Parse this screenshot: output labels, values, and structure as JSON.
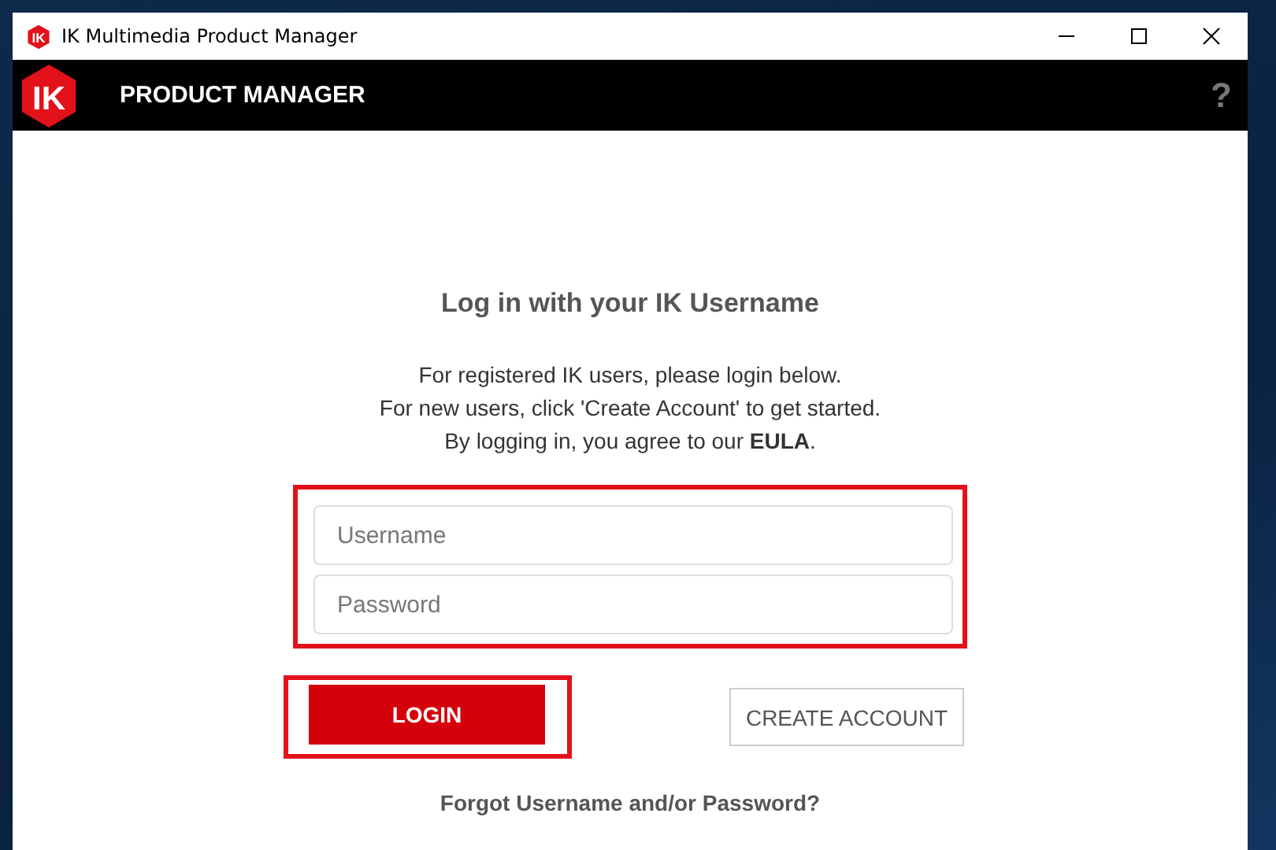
{
  "window": {
    "title": "IK Multimedia Product Manager",
    "logo_text": "IK"
  },
  "header": {
    "logo_text": "IK",
    "title": "PRODUCT MANAGER",
    "help": "?"
  },
  "login": {
    "heading": "Log in with your IK Username",
    "lines": [
      "For registered IK users, please login below.",
      "For new users, click 'Create Account' to get started.",
      "By logging in, you agree to our **EULA**."
    ],
    "fields_highlighted": true,
    "fields": [
      {
        "placeholder": "Username"
      },
      {
        "placeholder": "Password"
      }
    ],
    "login_button": {
      "label": "LOGIN",
      "highlighted": true
    },
    "create_button": {
      "label": "CREATE ACCOUNT"
    },
    "forgot": "Forgot Username and/or Password?"
  }
}
